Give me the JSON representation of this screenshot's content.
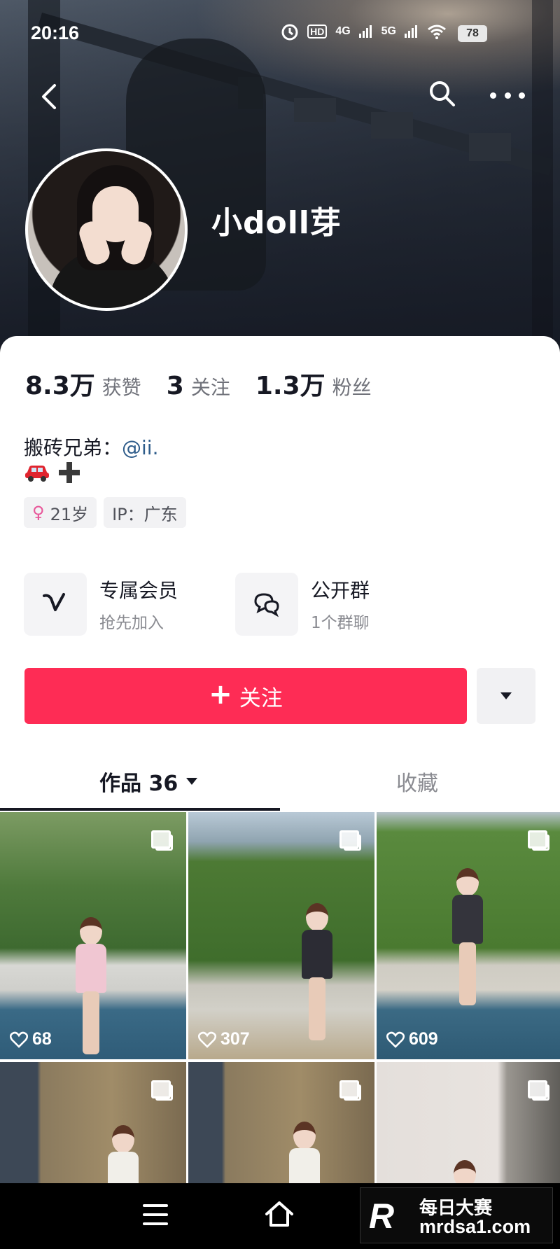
{
  "status_bar": {
    "time": "20:16",
    "network": "HD",
    "network_sub": "1 2",
    "cell1": "4G",
    "cell2": "5G",
    "battery": "78"
  },
  "profile": {
    "nickname": "小doll芽",
    "stats": [
      {
        "value": "8.3万",
        "label": "获赞"
      },
      {
        "value": "3",
        "label": "关注"
      },
      {
        "value": "1.3万",
        "label": "粉丝"
      }
    ],
    "bio_prefix": "搬砖兄弟：",
    "bio_mention": "@ii.",
    "emoji_car": "car-icon",
    "emoji_plus": "plus-icon",
    "tags": {
      "age": "21岁",
      "ip": "IP：广东"
    },
    "shortcuts": [
      {
        "title": "专属会员",
        "subtitle": "抢先加入",
        "icon": "vip-v-icon"
      },
      {
        "title": "公开群",
        "subtitle": "1个群聊",
        "icon": "group-chat-icon"
      }
    ],
    "follow_label": "关注",
    "follow_plus": "+"
  },
  "tabs": {
    "works": "作品 36",
    "favorites": "收藏"
  },
  "grid": [
    {
      "likes": "68"
    },
    {
      "likes": "307"
    },
    {
      "likes": "609"
    },
    {
      "likes": ""
    },
    {
      "likes": ""
    },
    {
      "likes": ""
    }
  ],
  "watermark": {
    "logo": "R",
    "top": "每日大赛",
    "bottom": "mrdsa1.com"
  },
  "colors": {
    "accent": "#fe2c55",
    "mention": "#2e5c8a",
    "gender": "#e8579a"
  }
}
